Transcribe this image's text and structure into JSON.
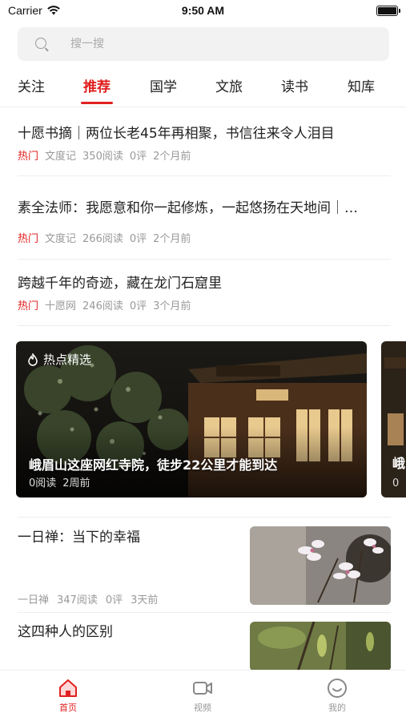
{
  "status_bar": {
    "carrier": "Carrier",
    "time": "9:50 AM"
  },
  "search": {
    "placeholder": "搜一搜"
  },
  "tabs": [
    {
      "label": "关注"
    },
    {
      "label": "推荐",
      "active": true
    },
    {
      "label": "国学"
    },
    {
      "label": "文旅"
    },
    {
      "label": "读书"
    },
    {
      "label": "知库"
    }
  ],
  "news": [
    {
      "title": "十愿书摘｜两位长老45年再相聚，书信往来令人泪目",
      "tag": "热门",
      "source": "文度记",
      "reads": "350阅读",
      "comments": "0评",
      "time": "2个月前"
    },
    {
      "title": "素全法师：我愿意和你一起修炼，一起悠扬在天地间｜…",
      "tag": "热门",
      "source": "文度记",
      "reads": "266阅读",
      "comments": "0评",
      "time": "2个月前"
    },
    {
      "title": "跨越千年的奇迹，藏在龙门石窟里",
      "tag": "热门",
      "source": "十愿网",
      "reads": "246阅读",
      "comments": "0评",
      "time": "3个月前"
    }
  ],
  "featured": {
    "label": "热点精选",
    "title": "峨眉山这座网红寺院，徒步22公里才能到达",
    "reads": "0阅读",
    "time": "2周前",
    "peek_title": "峨",
    "peek_meta": "0"
  },
  "thumb_items": [
    {
      "title": "一日禅：当下的幸福",
      "source": "一日禅",
      "reads": "347阅读",
      "comments": "0评",
      "time": "3天前"
    },
    {
      "title": "这四种人的区别"
    }
  ],
  "tab_bar": [
    {
      "label": "首页",
      "icon": "home-icon",
      "active": true
    },
    {
      "label": "视频",
      "icon": "video-icon"
    },
    {
      "label": "我的",
      "icon": "profile-icon"
    }
  ],
  "colors": {
    "accent": "#e02020",
    "meta": "#999999"
  }
}
